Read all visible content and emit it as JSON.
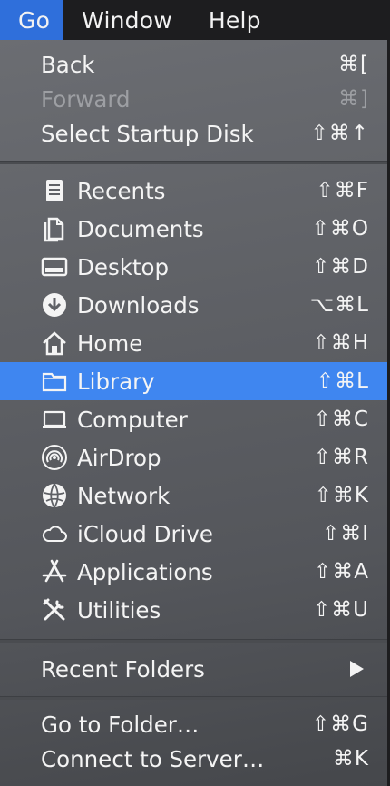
{
  "menubar": {
    "items": [
      {
        "label": "Go",
        "active": true
      },
      {
        "label": "Window",
        "active": false
      },
      {
        "label": "Help",
        "active": false
      }
    ]
  },
  "menu": {
    "group1": [
      {
        "label": "Back",
        "shortcut": "⌘[",
        "enabled": true
      },
      {
        "label": "Forward",
        "shortcut": "⌘]",
        "enabled": false
      },
      {
        "label": "Select Startup Disk",
        "shortcut": "⇧⌘↑",
        "enabled": true
      }
    ],
    "places": [
      {
        "label": "Recents",
        "shortcut": "⇧⌘F",
        "icon": "recents-icon"
      },
      {
        "label": "Documents",
        "shortcut": "⇧⌘O",
        "icon": "documents-icon"
      },
      {
        "label": "Desktop",
        "shortcut": "⇧⌘D",
        "icon": "desktop-icon"
      },
      {
        "label": "Downloads",
        "shortcut": "⌥⌘L",
        "icon": "downloads-icon"
      },
      {
        "label": "Home",
        "shortcut": "⇧⌘H",
        "icon": "home-icon"
      },
      {
        "label": "Library",
        "shortcut": "⇧⌘L",
        "icon": "folder-icon",
        "highlighted": true
      },
      {
        "label": "Computer",
        "shortcut": "⇧⌘C",
        "icon": "computer-icon"
      },
      {
        "label": "AirDrop",
        "shortcut": "⇧⌘R",
        "icon": "airdrop-icon"
      },
      {
        "label": "Network",
        "shortcut": "⇧⌘K",
        "icon": "network-icon"
      },
      {
        "label": "iCloud Drive",
        "shortcut": "⇧⌘I",
        "icon": "cloud-icon"
      },
      {
        "label": "Applications",
        "shortcut": "⇧⌘A",
        "icon": "applications-icon"
      },
      {
        "label": "Utilities",
        "shortcut": "⇧⌘U",
        "icon": "utilities-icon"
      }
    ],
    "recent_folders": {
      "label": "Recent Folders",
      "submenu": true
    },
    "group4": [
      {
        "label": "Go to Folder…",
        "shortcut": "⇧⌘G"
      },
      {
        "label": "Connect to Server…",
        "shortcut": "⌘K"
      }
    ]
  },
  "colors": {
    "highlight": "#3f86f0",
    "menubar_active": "#2f6fdb",
    "disabled_text": "#9d9fa3"
  }
}
